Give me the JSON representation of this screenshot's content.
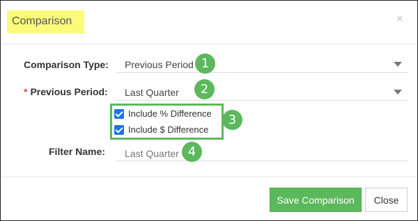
{
  "dialog": {
    "title": "Comparison",
    "close_glyph": "×"
  },
  "form": {
    "comparison_type": {
      "label": "Comparison Type:",
      "value": "Previous Period",
      "badge": "1"
    },
    "previous_period": {
      "required_mark": "*",
      "label": "Previous Period:",
      "value": "Last Quarter",
      "badge": "2"
    },
    "options": {
      "badge": "3",
      "include_percent": {
        "label": "Include % Difference",
        "checked": true
      },
      "include_dollar": {
        "label": "Include $ Difference",
        "checked": true
      }
    },
    "filter_name": {
      "label": "Filter Name:",
      "value": "Last Quarter",
      "badge": "4"
    }
  },
  "footer": {
    "save_label": "Save Comparison",
    "close_label": "Close"
  },
  "colors": {
    "accent_green": "#5cb85c",
    "title_highlight": "#fafb7a",
    "checkbox_blue": "#1a73e8"
  }
}
